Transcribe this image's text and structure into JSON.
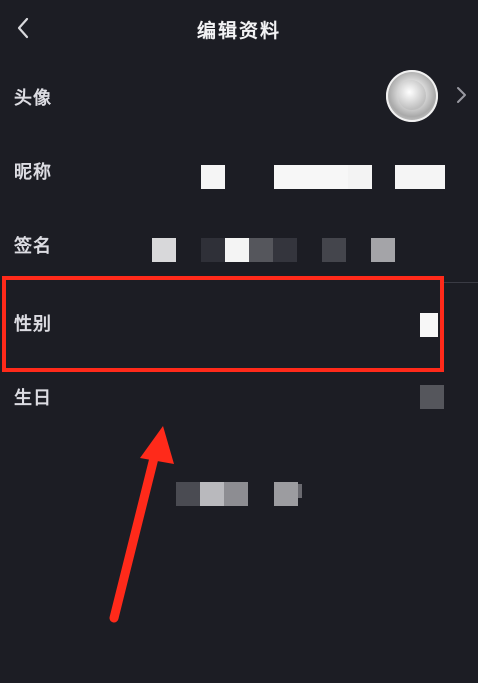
{
  "header": {
    "title": "编辑资料"
  },
  "rows": [
    {
      "label": "头像",
      "value": ""
    },
    {
      "label": "昵称",
      "value": ""
    },
    {
      "label": "签名",
      "value": ""
    },
    {
      "label": "性别",
      "value": ""
    },
    {
      "label": "生日",
      "value": ""
    }
  ],
  "icons": {
    "back": "chevron-left-icon",
    "avatar_chevron": "chevron-right-icon"
  },
  "colors": {
    "background": "#1c1d24",
    "highlight_box": "#ff2a1a",
    "arrow": "#ff2a1a",
    "text": "#dcdce2"
  }
}
